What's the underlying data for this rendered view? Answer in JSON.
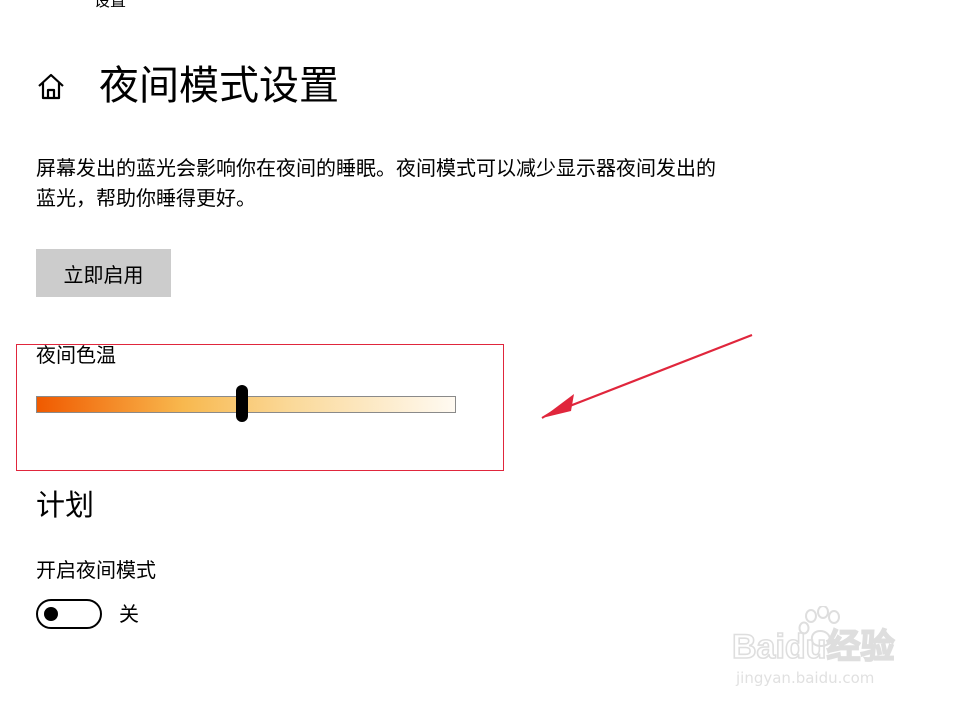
{
  "window": {
    "app_title": "设置"
  },
  "header": {
    "title": "夜间模式设置"
  },
  "description": "屏幕发出的蓝光会影响你在夜间的睡眠。夜间模式可以减少显示器夜间发出的蓝光，帮助你睡得更好。",
  "enable_button": {
    "label": "立即启用"
  },
  "color_temperature": {
    "label": "夜间色温",
    "value_fraction": 0.49,
    "gradient_colors": [
      "#f05a00",
      "#f8b84e",
      "#fad897",
      "#fffaf2"
    ]
  },
  "schedule": {
    "heading": "计划",
    "toggle_label": "开启夜间模式",
    "toggle_state": "关",
    "toggle_on": false
  },
  "annotation": {
    "highlight_color": "#e0263c"
  },
  "watermark": {
    "logo_text": "Baidu经验",
    "url": "jingyan.baidu.com"
  },
  "icons": {
    "back": "back-arrow-icon",
    "home": "home-icon"
  }
}
